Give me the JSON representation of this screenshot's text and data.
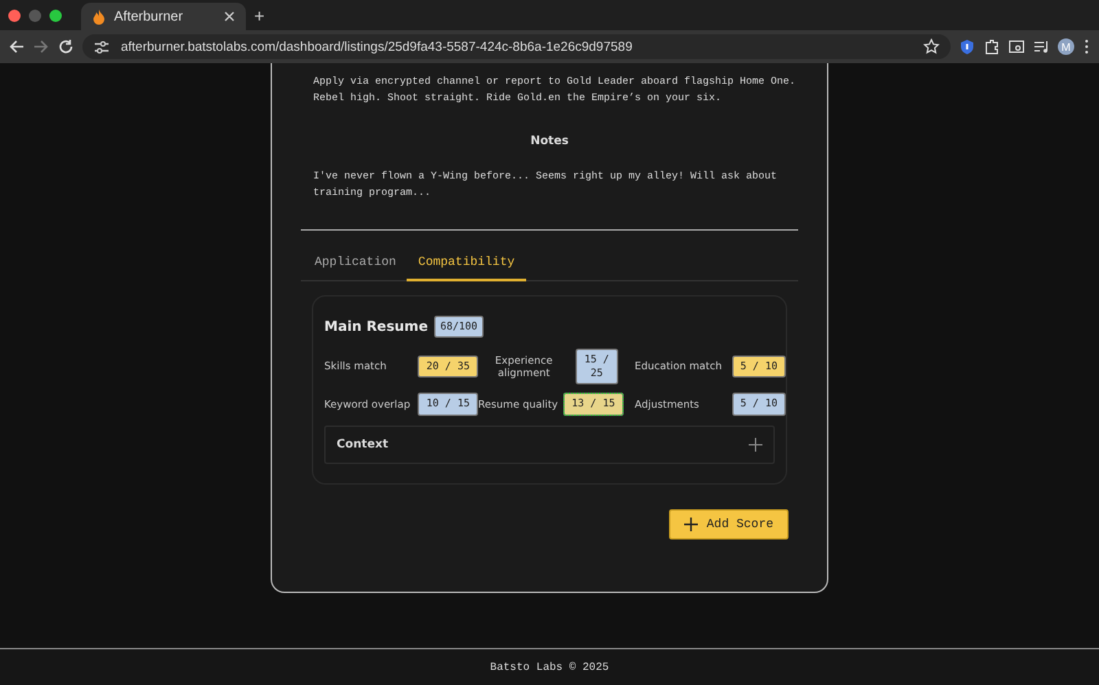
{
  "browser": {
    "tab_title": "Afterburner",
    "new_tab": "+",
    "url": "afterburner.batstolabs.com/dashboard/listings/25d9fa43-5587-424c-8b6a-1e26c9d97589",
    "avatar_initial": "M"
  },
  "listing": {
    "description": "Apply via encrypted channel or report to Gold Leader aboard flagship Home One. Rebel high. Shoot straight. Ride Gold.en the Empire’s on your six.",
    "notes_heading": "Notes",
    "notes": "I've never flown a Y-Wing before... Seems right up my alley! Will ask about training program...",
    "tabs": [
      {
        "label": "Application",
        "selected": false
      },
      {
        "label": "Compatibility",
        "selected": true
      }
    ],
    "score_panel": {
      "title": "Main Resume",
      "total": "68/100",
      "scores": [
        {
          "label": "Skills match",
          "value": "20 / 35",
          "color": "#f5d36b",
          "outlined": false
        },
        {
          "label": "Experience alignment",
          "value": "15 / 25",
          "color": "#b8cde6",
          "outlined": false
        },
        {
          "label": "Education match",
          "value": "5 / 10",
          "color": "#f5d36b",
          "outlined": false
        },
        {
          "label": "Keyword overlap",
          "value": "10 / 15",
          "color": "#b8cde6",
          "outlined": false
        },
        {
          "label": "Resume quality",
          "value": "13 / 15",
          "color": "#e8d58a",
          "outlined": true
        },
        {
          "label": "Adjustments",
          "value": "5 / 10",
          "color": "#b8cde6",
          "outlined": false
        }
      ],
      "context": {
        "label": "Context",
        "expanded": false
      }
    },
    "add_button": "Add Score"
  },
  "footer": "Batsto Labs © 2025"
}
